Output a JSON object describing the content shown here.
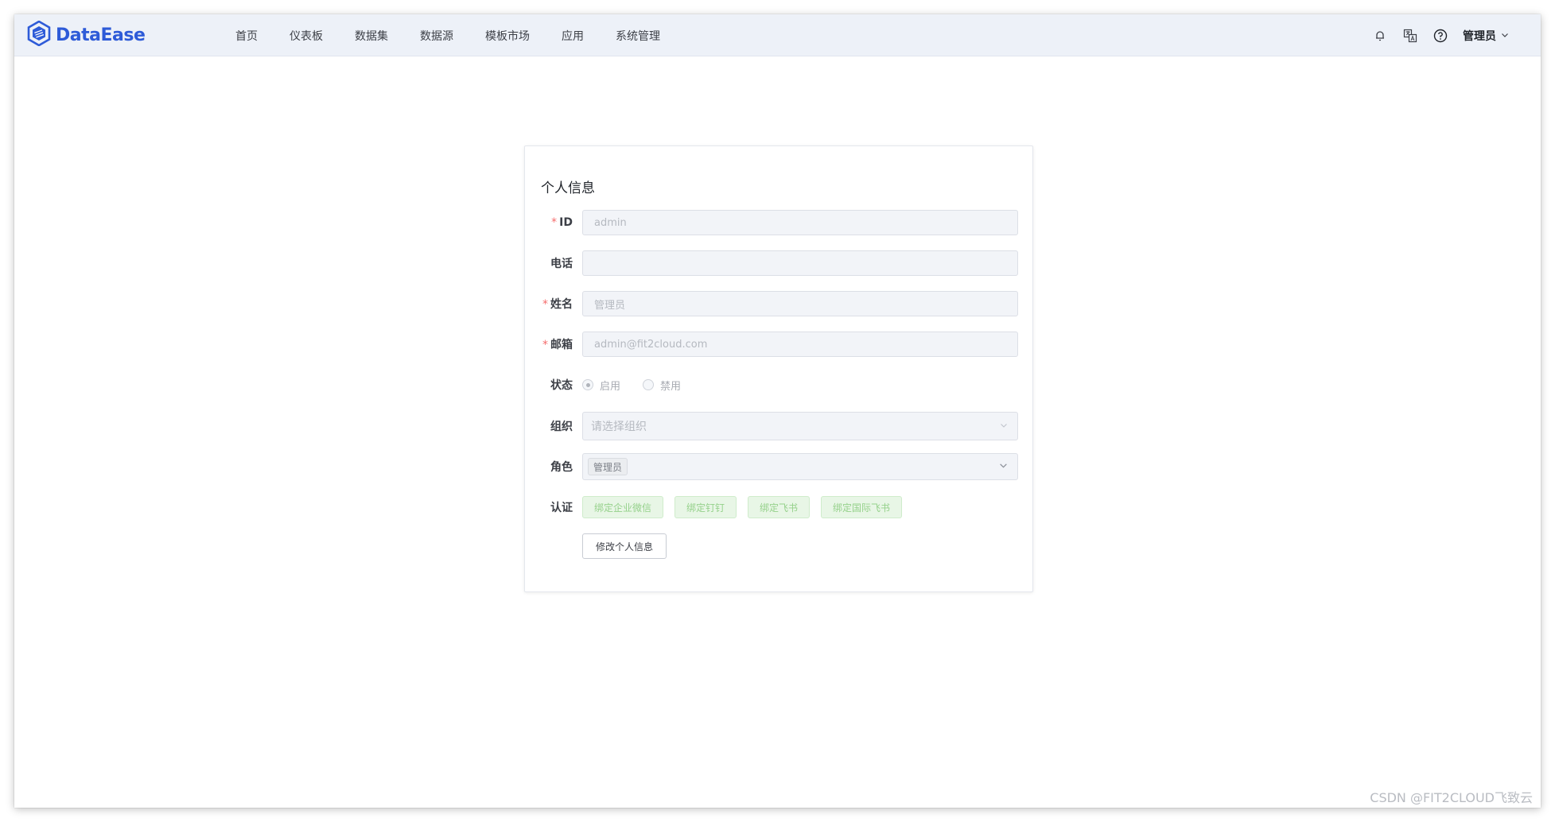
{
  "header": {
    "brand": "DataEase",
    "nav": [
      "首页",
      "仪表板",
      "数据集",
      "数据源",
      "模板市场",
      "应用",
      "系统管理"
    ],
    "user_name": "管理员",
    "icons": [
      "bell-icon",
      "translate-icon",
      "help-icon",
      "chevron-down-icon"
    ]
  },
  "profile": {
    "title": "个人信息",
    "id_label": "ID",
    "id_value": "admin",
    "phone_label": "电话",
    "phone_value": "",
    "name_label": "姓名",
    "name_value": "管理员",
    "email_label": "邮箱",
    "email_value": "admin@fit2cloud.com",
    "status_label": "状态",
    "status_options": [
      "启用",
      "禁用"
    ],
    "status_selected": "启用",
    "org_label": "组织",
    "org_placeholder": "请选择组织",
    "role_label": "角色",
    "role_tag": "管理员",
    "auth_label": "认证",
    "auth_buttons": [
      "绑定企业微信",
      "绑定钉钉",
      "绑定飞书",
      "绑定国际飞书"
    ],
    "edit_button": "修改个人信息"
  },
  "watermark": "CSDN @FIT2CLOUD飞致云",
  "colors": {
    "brand": "#2e5bd8",
    "required": "#f56c6c",
    "auth_green": "#95d18b"
  }
}
